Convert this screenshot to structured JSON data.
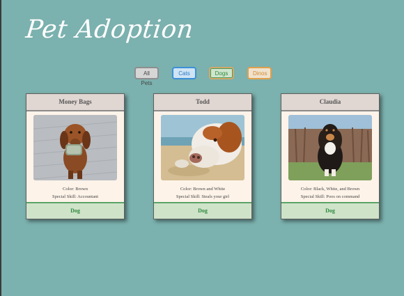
{
  "app": {
    "title": "Pet Adoption"
  },
  "filters": [
    {
      "label": "All Pets"
    },
    {
      "label": "Cats"
    },
    {
      "label": "Dogs"
    },
    {
      "label": "Dinos"
    }
  ],
  "pets": [
    {
      "name": "Money Bags",
      "color": "Color: Brown",
      "skill": "Special Skill: Accountant",
      "type": "Dog"
    },
    {
      "name": "Todd",
      "color": "Color: Brown and White",
      "skill": "Special Skill: Steals your girl",
      "type": "Dog"
    },
    {
      "name": "Claudia",
      "color": "Color: Black, White, and Brown",
      "skill": "Special Skill: Poos on command",
      "type": "Dog"
    }
  ],
  "colors": {
    "background": "#7bb1ae",
    "card": "#fdf3e9",
    "card_header": "#e0d6d2",
    "dog_footer": "#cfe3c9",
    "dog_text": "#2d8a3e"
  }
}
